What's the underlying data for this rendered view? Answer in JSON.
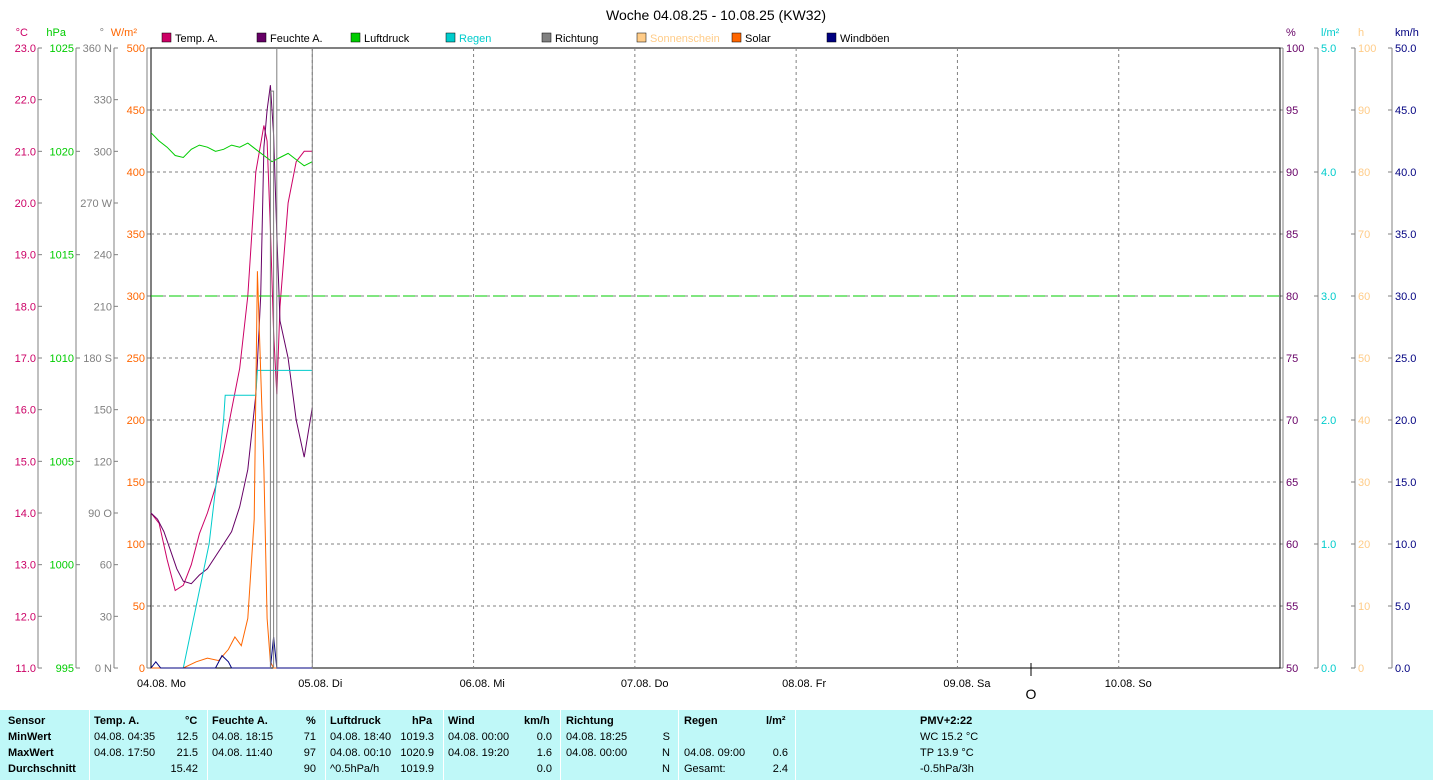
{
  "title": "Woche 04.08.25 - 10.08.25 (KW32)",
  "colors": {
    "temp": "#cc0066",
    "hum": "#660066",
    "press": "#00cc00",
    "rain": "#00cccc",
    "dir": "#808080",
    "sun": "#ffcc88",
    "solar": "#ff6600",
    "gust": "#000080",
    "table_bg": "#bff8f8"
  },
  "legend": [
    "Temp. A.",
    "Feuchte A.",
    "Luftdruck",
    "Regen",
    "Richtung",
    "Sonnenschein",
    "Solar",
    "Windböen"
  ],
  "units": {
    "temp": "°C",
    "press": "hPa",
    "dir": "°",
    "solar": "W/m²",
    "hum": "%",
    "rain": "l/m²",
    "sun": "h",
    "wind": "km/h"
  },
  "chart_data": {
    "type": "line",
    "title": "Woche 04.08.25 - 10.08.25 (KW32)",
    "x_ticks": [
      "04.08.  Mo",
      "05.08.  Di",
      "06.08.  Mi",
      "07.08.  Do",
      "08.08.  Fr",
      "09.08.  Sa",
      "10.08.  So"
    ],
    "x_range_days": [
      0,
      7
    ],
    "grid": true,
    "axes": {
      "temp": {
        "range": [
          11.0,
          23.0
        ],
        "ticks": [
          "11.0",
          "12.0",
          "13.0",
          "14.0",
          "15.0",
          "16.0",
          "17.0",
          "18.0",
          "19.0",
          "20.0",
          "21.0",
          "22.0",
          "23.0"
        ]
      },
      "press": {
        "range": [
          995,
          1025
        ],
        "ticks": [
          "995",
          "1000",
          "1005",
          "1010",
          "1015",
          "1020",
          "1025"
        ]
      },
      "dir": {
        "range": [
          0,
          360
        ],
        "ticks": [
          "0 N",
          "30",
          "60",
          "90  O",
          "120",
          "150",
          "180 S",
          "210",
          "240",
          "270 W",
          "300",
          "330",
          "360 N"
        ]
      },
      "solar": {
        "range": [
          0,
          500
        ],
        "ticks": [
          "0",
          "50",
          "100",
          "150",
          "200",
          "250",
          "300",
          "350",
          "400",
          "450",
          "500"
        ]
      },
      "hum": {
        "range": [
          50,
          100
        ],
        "ticks": [
          "50",
          "55",
          "60",
          "65",
          "70",
          "75",
          "80",
          "85",
          "90",
          "95",
          "100"
        ]
      },
      "rain": {
        "range": [
          0,
          5
        ],
        "ticks": [
          "0.0",
          "1.0",
          "2.0",
          "3.0",
          "4.0",
          "5.0"
        ]
      },
      "sun": {
        "range": [
          0,
          100
        ],
        "ticks": [
          "0",
          "10",
          "20",
          "30",
          "40",
          "50",
          "60",
          "70",
          "80",
          "90",
          "100"
        ]
      },
      "wind": {
        "range": [
          0,
          50
        ],
        "ticks": [
          "0.0",
          "5.0",
          "10.0",
          "15.0",
          "20.0",
          "25.0",
          "30.0",
          "35.0",
          "40.0",
          "45.0",
          "50.0"
        ]
      }
    },
    "series": [
      {
        "name": "Temp. A.",
        "axis": "temp",
        "x": [
          0,
          0.05,
          0.1,
          0.15,
          0.2,
          0.25,
          0.3,
          0.35,
          0.4,
          0.45,
          0.5,
          0.55,
          0.6,
          0.65,
          0.7,
          0.72,
          0.74,
          0.76,
          0.78,
          0.8,
          0.85,
          0.9,
          0.95,
          1.0
        ],
        "y": [
          14.0,
          13.8,
          13.1,
          12.5,
          12.6,
          13.0,
          13.6,
          14.0,
          14.5,
          15.2,
          16.0,
          16.8,
          18.2,
          20.6,
          21.5,
          21.2,
          19.5,
          17.5,
          16.3,
          18.0,
          20.0,
          20.8,
          21.0,
          21.0
        ]
      },
      {
        "name": "Feuchte A.",
        "axis": "hum",
        "x": [
          0,
          0.04,
          0.08,
          0.12,
          0.16,
          0.2,
          0.25,
          0.3,
          0.35,
          0.4,
          0.45,
          0.5,
          0.55,
          0.6,
          0.65,
          0.68,
          0.7,
          0.72,
          0.74,
          0.76,
          0.78,
          0.8,
          0.85,
          0.9,
          0.95,
          1.0
        ],
        "y": [
          62.5,
          62,
          61,
          59.5,
          58,
          57,
          56.8,
          57.5,
          58,
          59,
          60,
          61,
          63,
          66,
          72,
          80,
          92,
          95,
          97,
          93,
          85,
          78,
          75,
          70,
          67,
          71
        ]
      },
      {
        "name": "Luftdruck",
        "axis": "press",
        "x": [
          0,
          0.05,
          0.1,
          0.15,
          0.2,
          0.25,
          0.3,
          0.35,
          0.4,
          0.45,
          0.5,
          0.55,
          0.6,
          0.65,
          0.7,
          0.75,
          0.8,
          0.85,
          0.9,
          0.95,
          1.0
        ],
        "y": [
          1020.9,
          1020.5,
          1020.2,
          1019.8,
          1019.7,
          1020.1,
          1020.3,
          1020.2,
          1020.0,
          1020.1,
          1020.3,
          1020.2,
          1020.4,
          1020.1,
          1019.8,
          1019.5,
          1019.7,
          1019.9,
          1019.6,
          1019.3,
          1019.5
        ]
      },
      {
        "name": "Luftdruck Trend",
        "axis": "press",
        "x": [
          0,
          7
        ],
        "y": [
          1013.0,
          1013.0
        ],
        "dashed": true
      },
      {
        "name": "Regen",
        "axis": "rain",
        "x": [
          0,
          0.2,
          0.28,
          0.36,
          0.45,
          0.46,
          0.65,
          0.66,
          1.0
        ],
        "y": [
          0,
          0,
          0.5,
          1.0,
          2.0,
          2.2,
          2.2,
          2.4,
          2.4
        ]
      },
      {
        "name": "Solar",
        "axis": "solar",
        "x": [
          0,
          0.2,
          0.28,
          0.35,
          0.42,
          0.48,
          0.52,
          0.56,
          0.6,
          0.64,
          0.66,
          0.7,
          0.72,
          0.74,
          0.76,
          0.78,
          0.8,
          1.0
        ],
        "y": [
          0,
          0,
          5,
          8,
          6,
          15,
          25,
          18,
          40,
          120,
          320,
          160,
          40,
          5,
          0,
          0,
          0,
          0
        ]
      },
      {
        "name": "Windböen",
        "axis": "wind",
        "x": [
          0,
          0.03,
          0.06,
          0.1,
          0.2,
          0.4,
          0.44,
          0.48,
          0.5,
          0.62,
          0.74,
          0.76,
          0.78,
          0.8,
          1.0
        ],
        "y": [
          0,
          0.5,
          0,
          0,
          0,
          0,
          1.0,
          0.5,
          0,
          0,
          0,
          2.5,
          0,
          0,
          0
        ]
      },
      {
        "name": "Richtung",
        "axis": "dir",
        "x": [
          0.74,
          0.74,
          0.76,
          0.76
        ],
        "y": [
          0,
          335,
          335,
          0
        ]
      }
    ]
  },
  "compass_mark": "O",
  "table": {
    "headers": {
      "sensor": "Sensor",
      "temp": "Temp. A.",
      "temp_unit": "°C",
      "hum": "Feuchte A.",
      "hum_unit": "%",
      "press": "Luftdruck",
      "press_unit": "hPa",
      "wind": "Wind",
      "wind_unit": "km/h",
      "dir": "Richtung",
      "rain": "Regen",
      "rain_unit": "l/m²",
      "pmv": "PMV+2:22"
    },
    "rows": [
      {
        "label": "MinWert",
        "temp_time": "04.08.  04:35",
        "temp_val": "12.5",
        "hum_time": "04.08.  18:15",
        "hum_val": "71",
        "press_time": "04.08.  18:40",
        "press_val": "1019.3",
        "wind_time": "04.08.  00:00",
        "wind_val": "0.0",
        "dir_time": "04.08.  18:25",
        "dir_val": "S",
        "rain_time": "",
        "rain_val": "",
        "extra": "WC 15.2 °C"
      },
      {
        "label": "MaxWert",
        "temp_time": "04.08.  17:50",
        "temp_val": "21.5",
        "hum_time": "04.08.  11:40",
        "hum_val": "97",
        "press_time": "04.08.  00:10",
        "press_val": "1020.9",
        "wind_time": "04.08.  19:20",
        "wind_val": "1.6",
        "dir_time": "04.08.  00:00",
        "dir_val": "N",
        "rain_time": "04.08.  09:00",
        "rain_val": "0.6",
        "extra": "TP 13.9 °C"
      },
      {
        "label": "Durchschnitt",
        "temp_time": "",
        "temp_val": "15.42",
        "hum_time": "",
        "hum_val": "90",
        "press_time": "^0.5hPa/h",
        "press_val": "1019.9",
        "wind_time": "",
        "wind_val": "0.0",
        "dir_time": "",
        "dir_val": "N",
        "rain_time": "Gesamt:",
        "rain_val": "2.4",
        "extra": "-0.5hPa/3h"
      }
    ]
  }
}
